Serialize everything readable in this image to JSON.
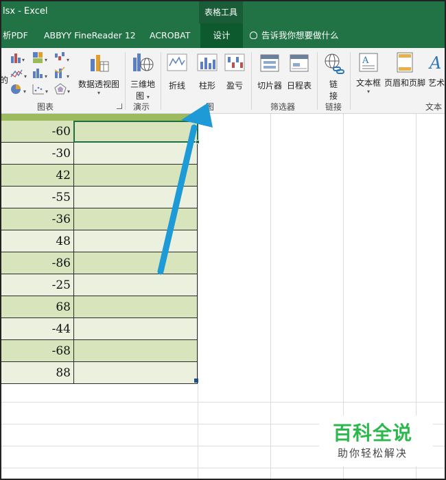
{
  "window": {
    "title": "lsx  -  Excel",
    "context_tab_group": "表格工具"
  },
  "tabs": [
    {
      "label": "析PDF"
    },
    {
      "label": "ABBYY FineReader 12"
    },
    {
      "label": "ACROBAT"
    },
    {
      "label": "设计"
    }
  ],
  "tell_me": "告诉我你想要做什么",
  "ribbon": {
    "charts_group": "图表",
    "pivot_chart": "数据透视图",
    "map_3d": "三维地\n图",
    "map_3d_line1": "三维地",
    "map_3d_line2": "图",
    "tours_group": "演示",
    "spark_line": "折线",
    "spark_column": "柱形",
    "spark_winloss": "盈亏",
    "sparklines_group": "图",
    "slicer": "切片器",
    "timeline": "日程表",
    "filters_group": "筛选器",
    "link_line1": "链",
    "link_line2": "接",
    "links_group": "链接",
    "textbox": "文本框",
    "header_footer": "页眉和页脚",
    "wordart": "艺术",
    "text_group": "文本",
    "left_fragment": "的"
  },
  "sheet": {
    "colA_values": [
      "-60",
      "-30",
      "42",
      "-55",
      "-36",
      "48",
      "-86",
      "-25",
      "68",
      "-44",
      "-68",
      "88"
    ]
  },
  "watermark": {
    "title": "百科全说",
    "subtitle": "助你轻松解决"
  },
  "colors": {
    "excel_green": "#217346",
    "band_dark": "#d8e4bc",
    "band_light": "#ebf1de",
    "arrow_blue": "#1e9ad6",
    "watermark_green": "#2db84d"
  }
}
